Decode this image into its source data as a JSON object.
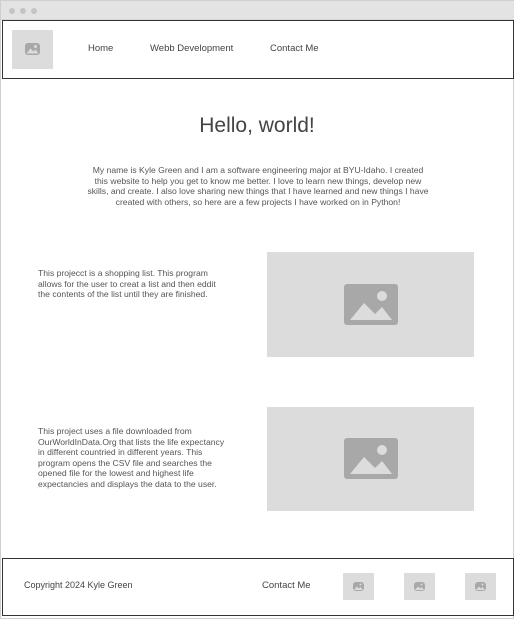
{
  "window": {
    "controls": [
      "dot",
      "dot",
      "dot"
    ]
  },
  "header": {
    "logo_icon": "image-placeholder-icon",
    "nav": [
      {
        "label": "Home"
      },
      {
        "label": "Webb Development"
      },
      {
        "label": "Contact Me"
      }
    ]
  },
  "hero": {
    "title": "Hello, world!",
    "text": "My name is Kyle Green and I am a software engineering major at BYU-Idaho. I created this website to help you get to know me better. I love to learn new things, develop new skills, and create. I also love sharing new things that I have learned and new things I have created with others, so here are a few projects I have worked on in Python!"
  },
  "projects": [
    {
      "description": "This projecct is a shopping list. This program allows for the user to creat a list and then eddit the contents of the list until they are finished.",
      "image_icon": "image-placeholder-icon"
    },
    {
      "description": "This project uses a file downloaded from OurWorldInData.Org that lists the life expectancy in different countried in different years. This program opens the CSV file and searches the opened file for the lowest and highest life expectancies and displays the data to the user.",
      "image_icon": "image-placeholder-icon"
    }
  ],
  "footer": {
    "copyright": "Copyright 2024 Kyle Green",
    "contact_label": "Contact Me",
    "social_icons": [
      "image-placeholder-icon",
      "image-placeholder-icon",
      "image-placeholder-icon"
    ]
  },
  "colors": {
    "placeholder_bg": "#dcdcdc",
    "placeholder_glyph": "#a8a8a8",
    "border": "#333333",
    "text": "#555555"
  }
}
